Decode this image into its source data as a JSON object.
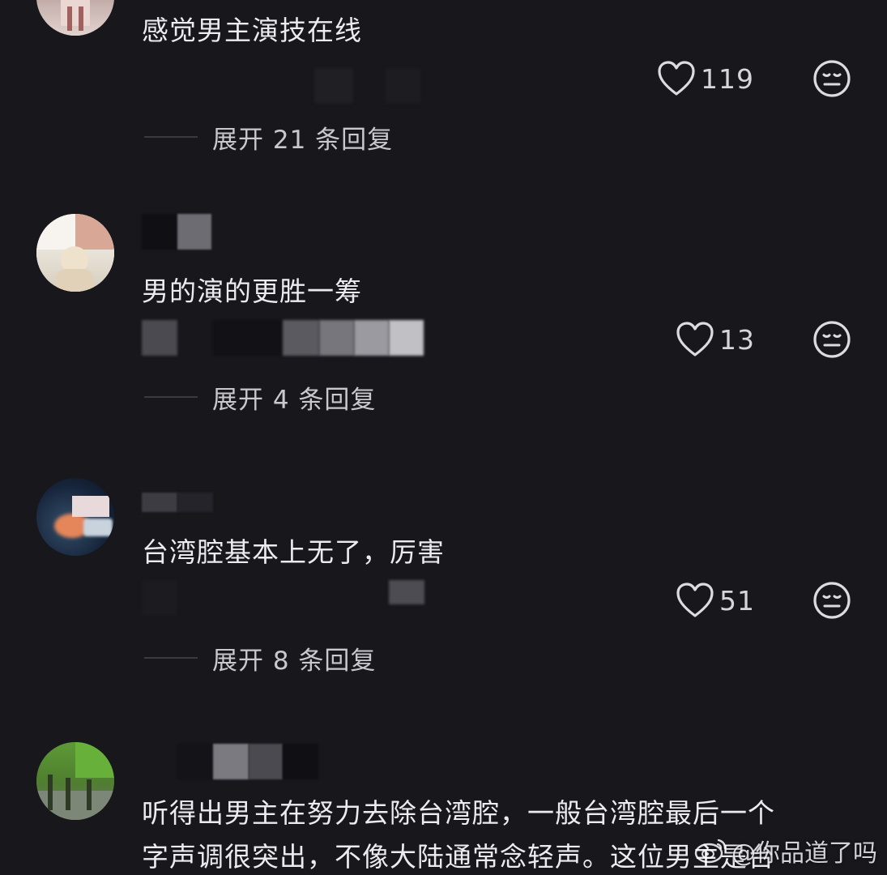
{
  "comments": [
    {
      "text": "感觉男主演技在线",
      "likes": "119",
      "expand_label": "展开 21 条回复"
    },
    {
      "text": "男的演的更胜一筹",
      "likes": "13",
      "expand_label": "展开 4 条回复"
    },
    {
      "text": "台湾腔基本上无了，厉害",
      "likes": "51",
      "expand_label": "展开 8 条回复"
    },
    {
      "text_line1": "听得出男主在努力去除台湾腔，一般台湾腔最后一个",
      "text_line2": "字声调很突出，不像大陆通常念轻声。这位男主是台"
    }
  ],
  "watermark": {
    "text": "@你品道了吗",
    "icon": "weibo-icon"
  },
  "colors": {
    "background": "#17171c",
    "text": "#ececef",
    "secondary": "#c8c8cd"
  },
  "icons": {
    "like": "heart-outline-icon",
    "dislike": "meh-face-icon"
  }
}
